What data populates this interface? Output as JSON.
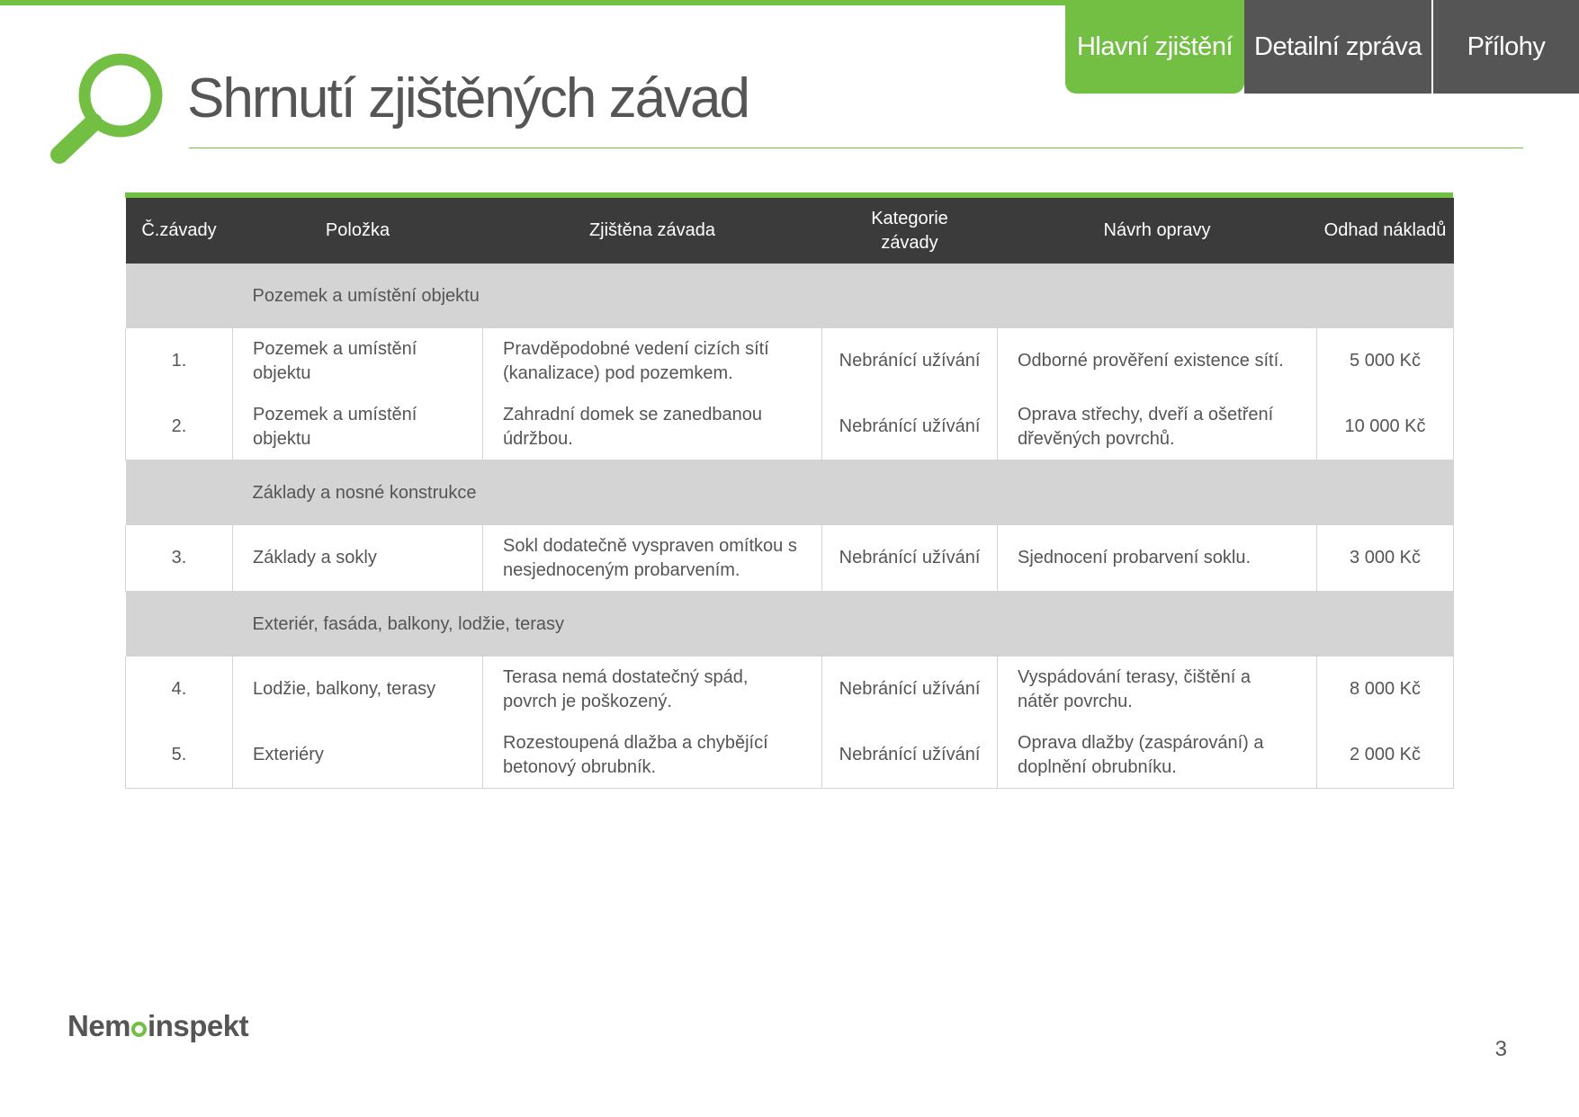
{
  "tabs": [
    {
      "label": "Hlavní zjištění",
      "active": true
    },
    {
      "label": "Detailní zpráva",
      "active": false
    },
    {
      "label": "Přílohy",
      "active": false
    }
  ],
  "page": {
    "title": "Shrnutí zjištěných závad",
    "page_number": "3"
  },
  "brand": {
    "logo_left": "Nem",
    "logo_right": "inspekt",
    "accent_color": "#72bf44",
    "dark_color": "#555555",
    "header_color": "#3b3b3b",
    "section_color": "#d4d4d4"
  },
  "icons": {
    "title_icon": "magnifier-icon"
  },
  "table": {
    "headers": {
      "num": "Č.závady",
      "item": "Položka",
      "defect": "Zjištěna závada",
      "category": "Kategorie závady",
      "fix": "Návrh opravy",
      "cost": "Odhad nákladů"
    },
    "sections": [
      {
        "label": "Pozemek a umístění objektu",
        "rows": [
          {
            "num": "1.",
            "item": "Pozemek a umístění objektu",
            "defect": "Pravděpodobné vedení cizích sítí (kanalizace) pod pozemkem.",
            "category": "Nebránící užívání",
            "fix": "Odborné prověření existence sítí.",
            "cost": "5 000 Kč"
          },
          {
            "num": "2.",
            "item": "Pozemek a umístění objektu",
            "defect": "Zahradní domek se zanedbanou údržbou.",
            "category": "Nebránící užívání",
            "fix": "Oprava střechy, dveří a ošetření dřevěných povrchů.",
            "cost": "10 000 Kč"
          }
        ]
      },
      {
        "label": "Základy a nosné konstrukce",
        "rows": [
          {
            "num": "3.",
            "item": "Základy a sokly",
            "defect": "Sokl dodatečně vyspraven omítkou s nesjednoceným probarvením.",
            "category": "Nebránící užívání",
            "fix": "Sjednocení probarvení soklu.",
            "cost": "3 000 Kč"
          }
        ]
      },
      {
        "label": "Exteriér, fasáda, balkony, lodžie, terasy",
        "rows": [
          {
            "num": "4.",
            "item": "Lodžie, balkony, terasy",
            "defect": "Terasa nemá dostatečný spád, povrch je poškozený.",
            "category": "Nebránící užívání",
            "fix": "Vyspádování terasy, čištění a nátěr povrchu.",
            "cost": "8 000 Kč"
          },
          {
            "num": "5.",
            "item": "Exteriéry",
            "defect": "Rozestoupená dlažba a chybějící betonový obrubník.",
            "category": "Nebránící užívání",
            "fix": "Oprava dlažby (zaspárování) a doplnění obrubníku.",
            "cost": "2 000 Kč"
          }
        ]
      }
    ]
  }
}
